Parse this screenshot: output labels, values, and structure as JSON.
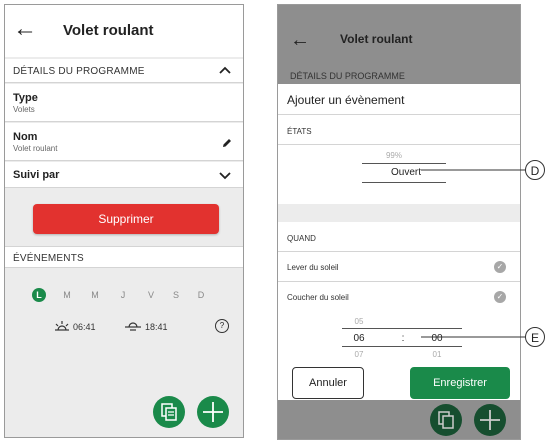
{
  "left": {
    "back": "←",
    "title": "Volet roulant",
    "details_header": "DÉTAILS DU PROGRAMME",
    "type_label": "Type",
    "type_value": "Volets",
    "nom_label": "Nom",
    "nom_value": "Volet roulant",
    "suivi_label": "Suivi par",
    "delete_label": "Supprimer",
    "events_header": "ÉVÉNEMENTS",
    "days": [
      "L",
      "M",
      "M",
      "J",
      "V",
      "S",
      "D"
    ],
    "sunrise_time": "06:41",
    "sunset_time": "18:41",
    "help": "?"
  },
  "right": {
    "back": "←",
    "title": "Volet roulant",
    "details_header": "DÉTAILS DU PROGRAMME",
    "sheet_title": "Ajouter un évènement",
    "states_label": "ÉTATS",
    "state_prev": "99%",
    "state_selected": "Ouvert",
    "when_label": "QUAND",
    "sunrise_option": "Lever du soleil",
    "sunset_option": "Coucher du soleil",
    "hour_prev": "05",
    "hour": "06",
    "hour_next": "07",
    "separator": ":",
    "minute": "00",
    "minute_next": "01",
    "cancel_label": "Annuler",
    "save_label": "Enregistrer"
  },
  "callouts": {
    "d": "D",
    "e": "E"
  },
  "colors": {
    "accent_green": "#1a8a4a",
    "delete_red": "#e2322f"
  }
}
